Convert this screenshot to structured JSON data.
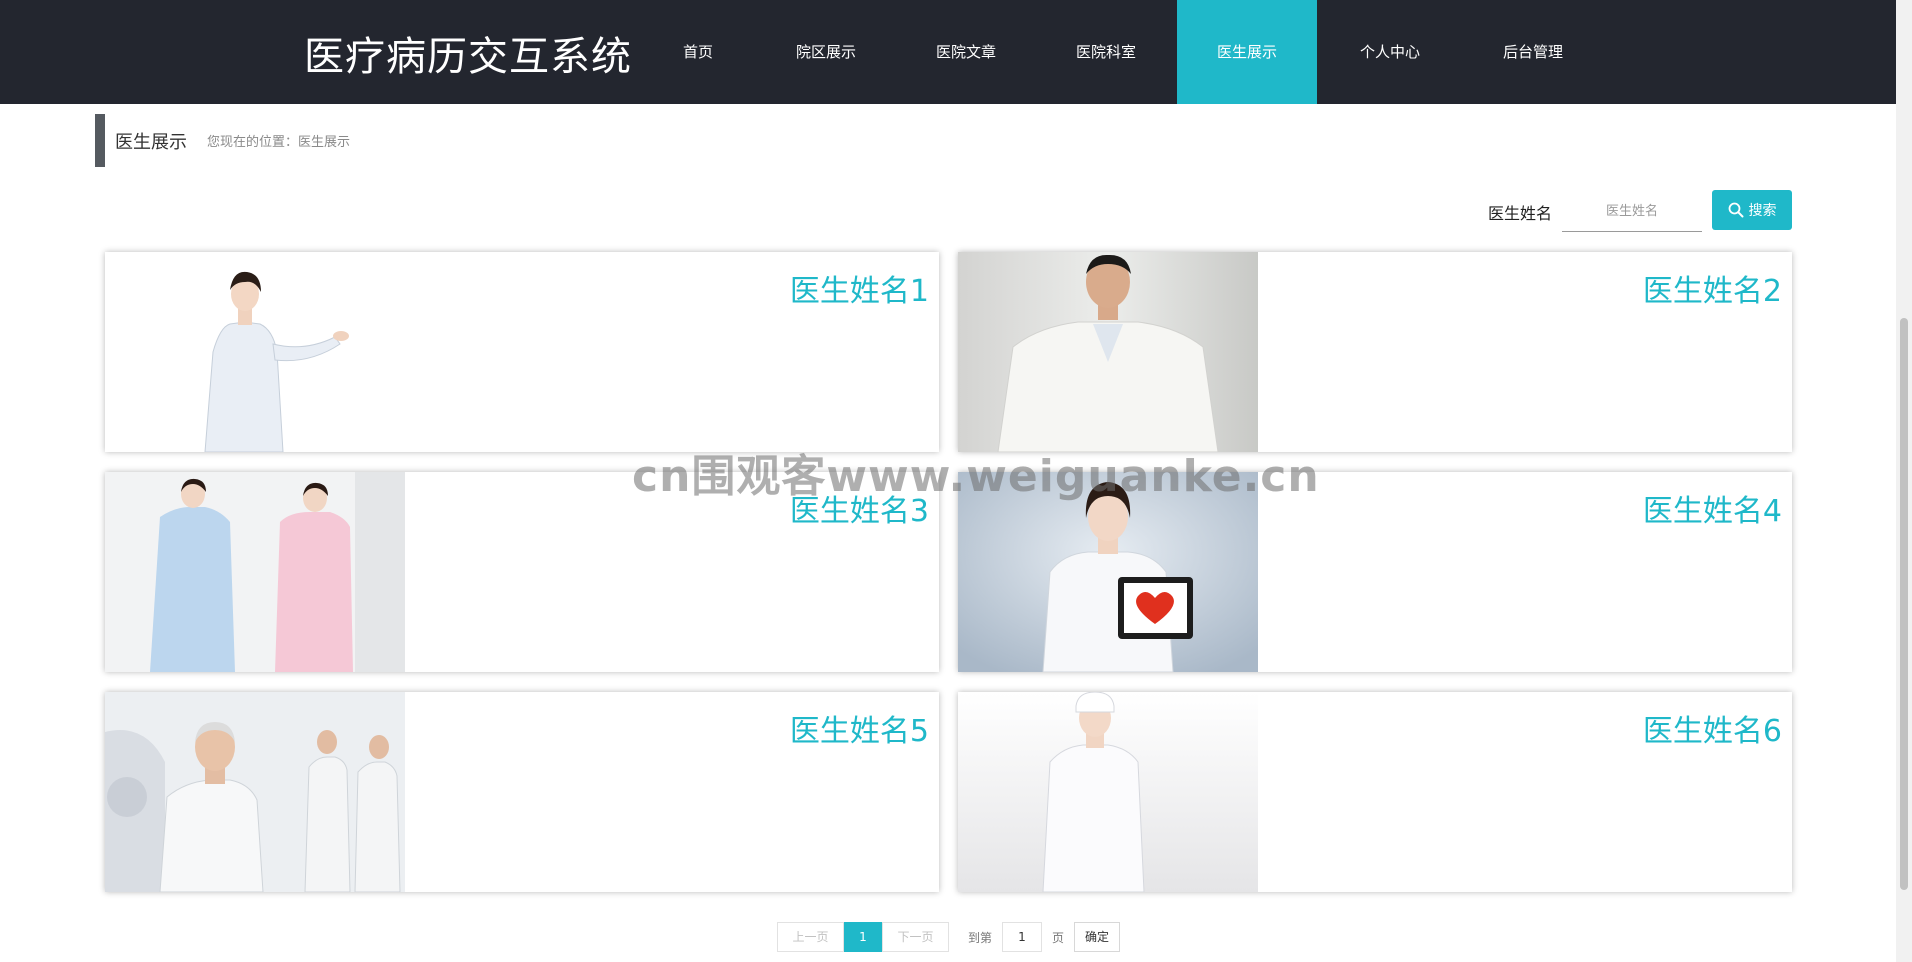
{
  "header": {
    "brand": "医疗病历交互系统",
    "nav": [
      "首页",
      "院区展示",
      "医院文章",
      "医院科室",
      "医生展示",
      "个人中心",
      "后台管理"
    ],
    "active_index": 4
  },
  "breadcrumb": {
    "title": "医生展示",
    "path": "您现在的位置：医生展示"
  },
  "search": {
    "label": "医生姓名",
    "placeholder": "医生姓名",
    "value": "",
    "button": "搜索"
  },
  "doctors": [
    {
      "name": "医生姓名1",
      "photo": "female-doctor-white-coat-photo"
    },
    {
      "name": "医生姓名2",
      "photo": "male-doctor-short-sleeve-photo"
    },
    {
      "name": "医生姓名3",
      "photo": "two-nurses-photo"
    },
    {
      "name": "医生姓名4",
      "photo": "doctor-holding-heart-tablet-photo"
    },
    {
      "name": "医生姓名5",
      "photo": "senior-doctor-ct-room-photo"
    },
    {
      "name": "医生姓名6",
      "photo": "nurse-white-uniform-photo"
    }
  ],
  "watermark": "cn围观客www.weiguanke.cn",
  "pagination": {
    "prev": "上一页",
    "current": "1",
    "next": "下一页",
    "goto_prefix": "到第",
    "goto_value": "1",
    "goto_suffix": "页",
    "confirm": "确定"
  },
  "colors": {
    "topbar": "#23262f",
    "accent": "#1fb8c9"
  }
}
